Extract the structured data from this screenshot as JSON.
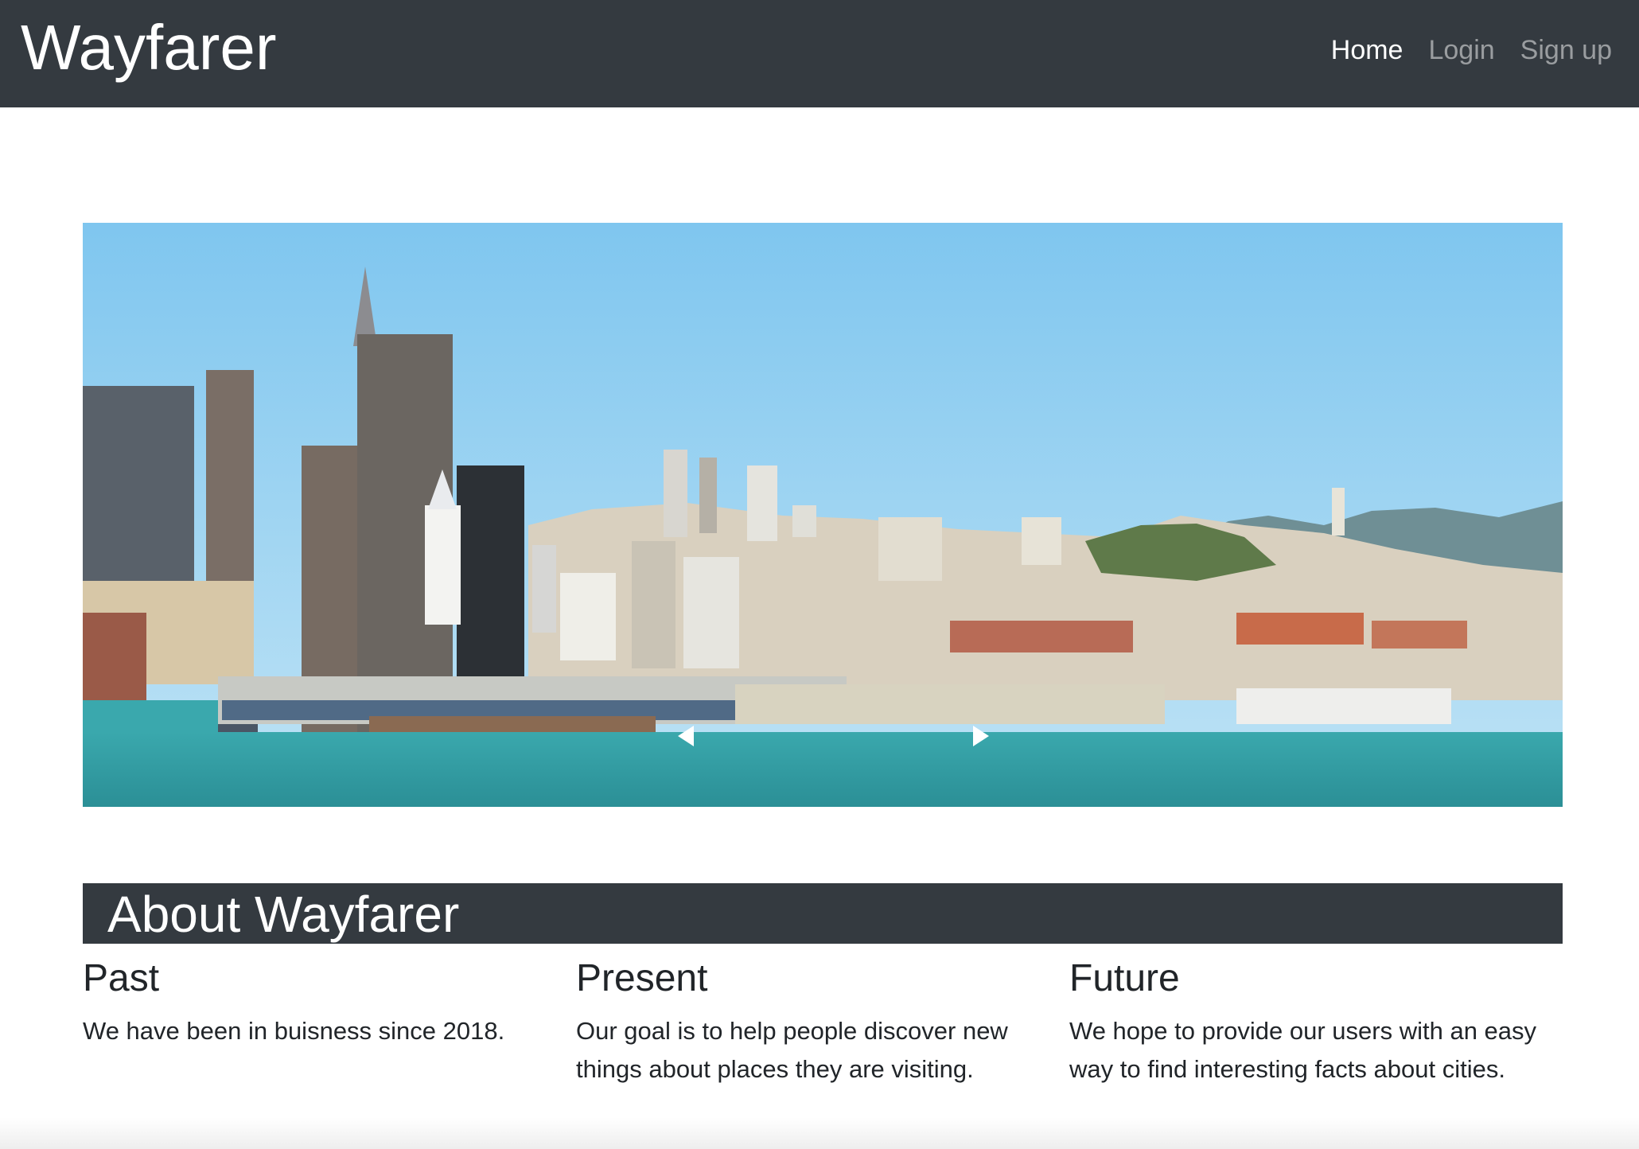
{
  "navbar": {
    "brand": "Wayfarer",
    "links": [
      {
        "label": "Home",
        "active": true
      },
      {
        "label": "Login",
        "active": false
      },
      {
        "label": "Sign up",
        "active": false
      }
    ]
  },
  "carousel": {
    "slide_description": "San Francisco waterfront skyline",
    "prev_icon": "chevron-left-icon",
    "next_icon": "chevron-right-icon"
  },
  "about": {
    "title": "About Wayfarer",
    "columns": [
      {
        "heading": "Past",
        "text": "We have been in buisness since 2018."
      },
      {
        "heading": "Present",
        "text": "Our goal is to help people discover new things about places they are visiting."
      },
      {
        "heading": "Future",
        "text": "We hope to provide our users with an easy way to find interesting facts about cities."
      }
    ]
  },
  "colors": {
    "navbar_bg": "#343a40",
    "nav_active": "#ffffff",
    "nav_inactive": "#9a9da0",
    "sky": "#8fd0f2",
    "water": "#3aa6a6"
  }
}
